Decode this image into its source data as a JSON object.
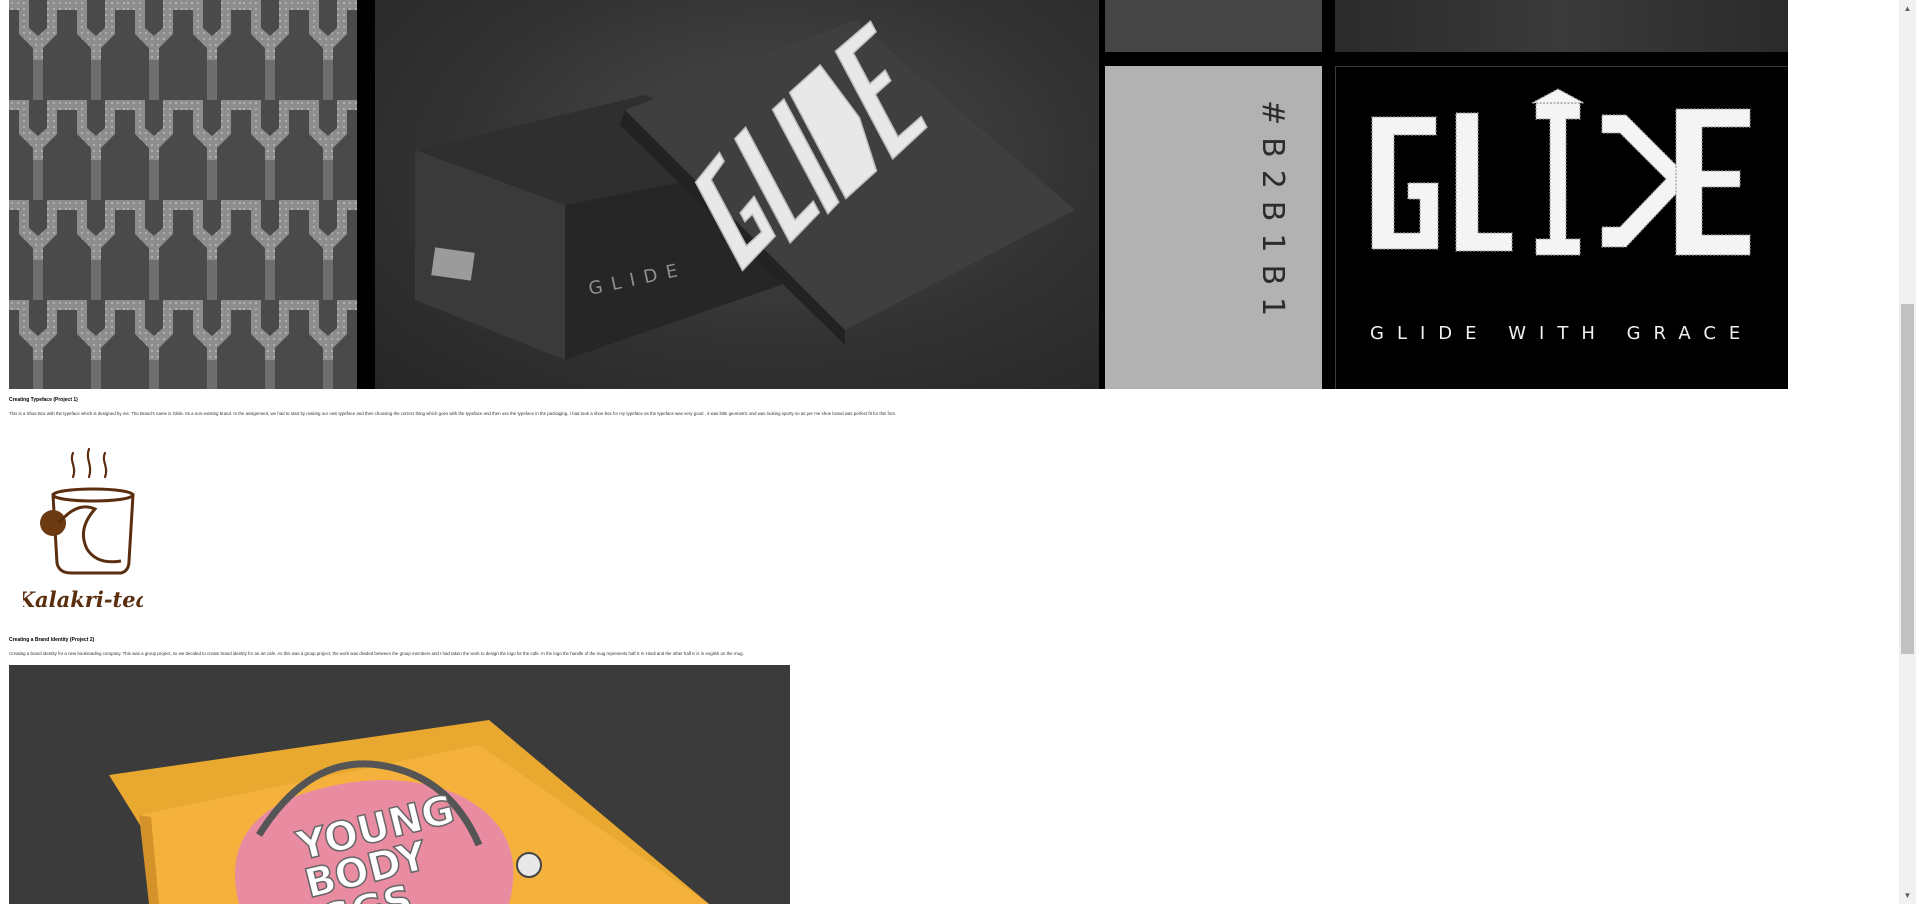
{
  "project1": {
    "swatch_code": "#B2B1B1",
    "box_print": "GLIDE",
    "logo_tagline": "GLIDE WITH GRACE",
    "title": "Creating Typeface (Project 1)",
    "description": "This is a Shoe Box with the typeface which is designed by me. The Brand’s name is Glide. Its a non-existing brand. In the assignment, we had to start by making our own typeface and then choosing the correct thing which goes with the typeface and then use the typeface in the packaging. I had took a shoe box for my typeface as the typeface was very good , it was little geometric and was looking sporty so as per me shoe brand was perfect fit for this font."
  },
  "project2": {
    "logo_text": "Kalakri-tea",
    "title": "Creating a Brand Identity (Project 2)",
    "description": "Creating a brand identity for a new bookreading company. This was a group project, so we decided to create brand identity for an art cafe. As this was a group project, the work was divided between the group members and I had taken the work to design the logo for the cafe. In the logo the handle of the mug represents half K in Hindi and the other half K is in english on the mug."
  },
  "project3": {
    "book_title_line1": "YOUNG",
    "book_title_line2": "BODY",
    "book_title_line3": "GGS"
  },
  "colors": {
    "swatch": "#B2B1B1",
    "tea_brown": "#5a2e0e",
    "book_orange": "#f4b23c"
  },
  "scrollbar": {
    "up_icon": "▲",
    "down_icon": "▼"
  }
}
